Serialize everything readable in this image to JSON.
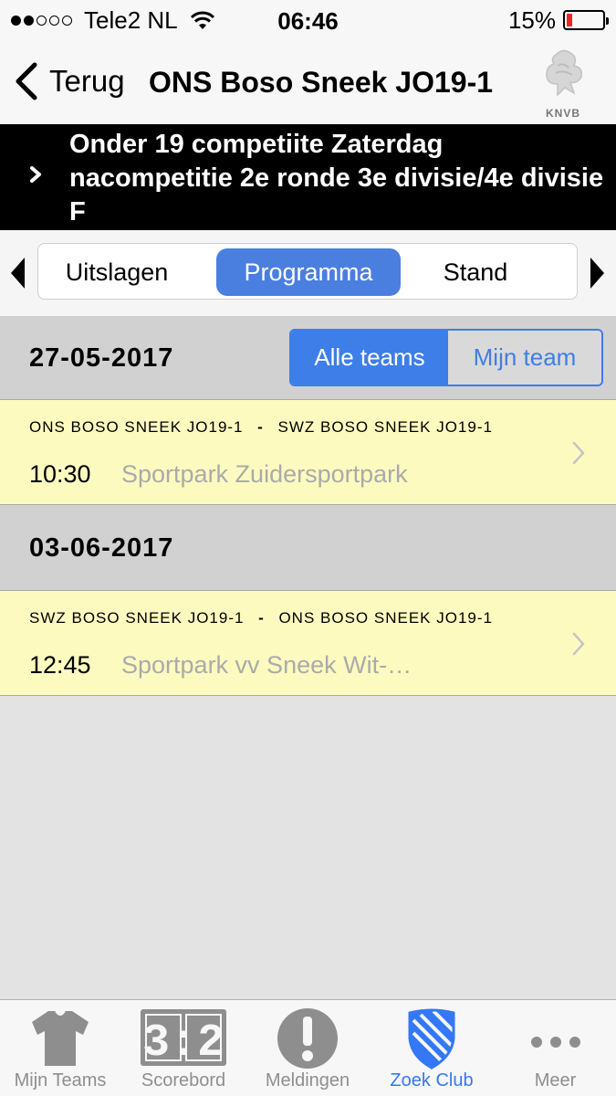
{
  "status_bar": {
    "carrier": "Tele2 NL",
    "signal_bars": 2,
    "time": "06:46",
    "battery_percent": "15%",
    "battery_level": 0.15,
    "battery_color": "#e8262a"
  },
  "nav": {
    "back_label": "Terug",
    "title": "ONS Boso Sneek JO19-1",
    "logo_text": "KNVB"
  },
  "competition": {
    "title": "Onder 19 competiite Zaterdag nacompetitie 2e ronde 3e divisie/4e divisie F"
  },
  "segments": {
    "items": [
      "Uitslagen",
      "Programma",
      "Stand"
    ],
    "selected": "Programma",
    "accent": "#4a7fe0"
  },
  "filter": {
    "all_label": "Alle teams",
    "mine_label": "Mijn team",
    "selected": "Alle teams"
  },
  "days": [
    {
      "date": "27-05-2017",
      "matches": [
        {
          "home": "ONS BOSO SNEEK JO19-1",
          "away": "SWZ BOSO SNEEK JO19-1",
          "separator": "-",
          "time": "10:30",
          "venue": "Sportpark Zuidersportpark"
        }
      ]
    },
    {
      "date": "03-06-2017",
      "matches": [
        {
          "home": "SWZ BOSO SNEEK JO19-1",
          "away": "ONS BOSO SNEEK JO19-1",
          "separator": "-",
          "time": "12:45",
          "venue": "Sportpark vv Sneek Wit-…"
        }
      ]
    }
  ],
  "tabbar": {
    "items": [
      {
        "label": "Mijn Teams",
        "icon": "shirt-icon"
      },
      {
        "label": "Scorebord",
        "icon": "scoreboard-icon",
        "icon_text": "3:2"
      },
      {
        "label": "Meldingen",
        "icon": "exclamation-icon"
      },
      {
        "label": "Zoek Club",
        "icon": "shield-icon"
      },
      {
        "label": "Meer",
        "icon": "more-dots-icon"
      }
    ],
    "active": "Zoek Club",
    "active_color": "#3478f6"
  }
}
